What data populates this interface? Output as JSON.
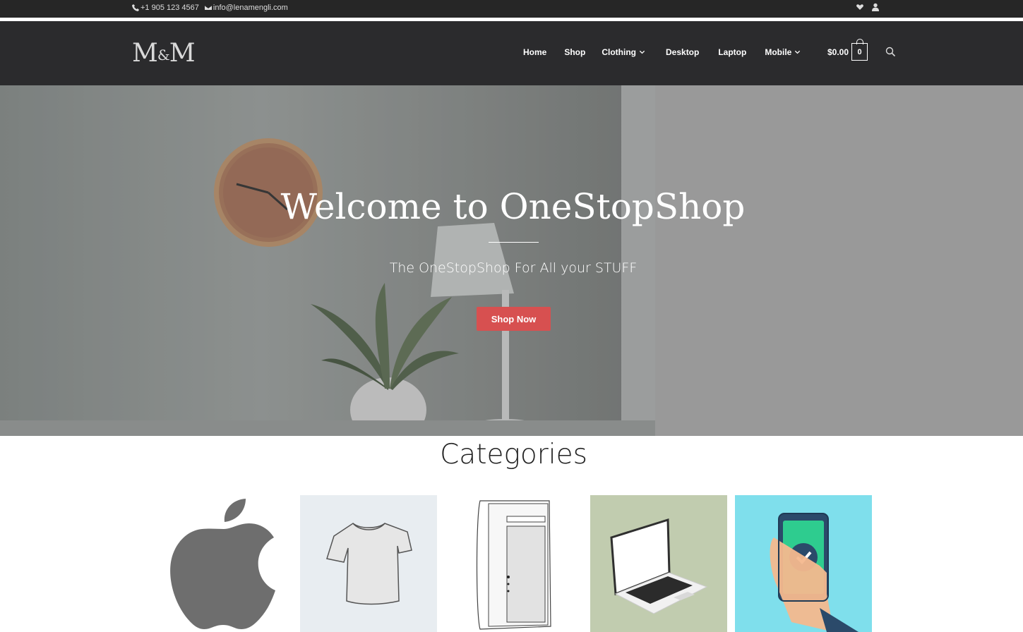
{
  "topbar": {
    "phone": "+1 905 123 4567",
    "email": "info@lenamengli.com",
    "icons": [
      "phone-icon",
      "envelope-icon",
      "heart-icon",
      "user-icon"
    ]
  },
  "header": {
    "logo": {
      "left": "M",
      "amp": "&",
      "right": "M"
    },
    "nav": [
      {
        "label": "Home",
        "dropdown": false
      },
      {
        "label": "Shop",
        "dropdown": false
      },
      {
        "label": "Clothing",
        "dropdown": true
      },
      {
        "label": "Desktop",
        "dropdown": false
      },
      {
        "label": "Laptop",
        "dropdown": false
      },
      {
        "label": "Mobile",
        "dropdown": true
      }
    ],
    "cart": {
      "total": "$0.00",
      "count": "0"
    }
  },
  "hero": {
    "title": "Welcome to OneStopShop",
    "subtitle": "The OneStopShop For All your STUFF",
    "button": "Shop Now"
  },
  "categories": {
    "title": "Categories",
    "tiles": [
      "apple-logo-icon",
      "tshirt-icon",
      "desktop-tower-icon",
      "laptop-icon",
      "smartphone-check-icon"
    ]
  },
  "colors": {
    "topbar_bg": "#262626",
    "header_bg": "#2b2b2d",
    "accent": "#d75050"
  }
}
